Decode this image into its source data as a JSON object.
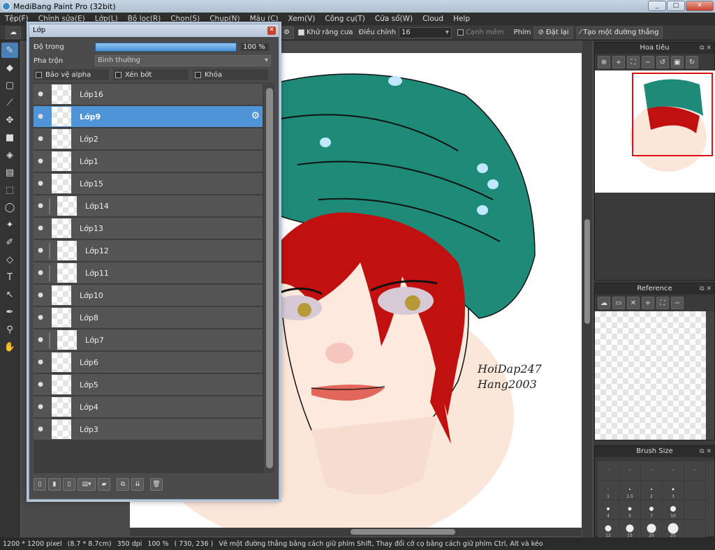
{
  "window": {
    "title": "MediBang Paint Pro (32bit)",
    "min": "_",
    "max": "□",
    "close": "✕"
  },
  "menu": [
    "Tệp(F)",
    "Chỉnh sửa(E)",
    "Lớp(L)",
    "Bộ lọc(R)",
    "Chọn(S)",
    "Chụp(N)",
    "Màu (C)",
    "Xem(V)",
    "Công cụ(T)",
    "Cửa sổ(W)",
    "Cloud",
    "Help"
  ],
  "toolbar": {
    "antialias": "Khử răng cưa",
    "correction_label": "Điều chỉnh",
    "correction_value": "16",
    "soft_edge": "Cạnh mềm",
    "key_label": "Phím",
    "reset": "Đặt lại",
    "straight_line": "Tạo một đường thẳng"
  },
  "layer_panel": {
    "title": "Lớp",
    "opacity_label": "Độ trong",
    "opacity_value": "100 %",
    "opacity": 1.0,
    "blend_label": "Pha trộn",
    "blend_value": "Bình thường",
    "protect_alpha": "Bảo vệ alpha",
    "clipping": "Xén bớt",
    "lock": "Khóa",
    "layers": [
      {
        "name": "Lớp16",
        "selected": false,
        "clipped": false
      },
      {
        "name": "Lớp9",
        "selected": true,
        "clipped": false
      },
      {
        "name": "Lớp2",
        "selected": false,
        "clipped": false
      },
      {
        "name": "Lớp1",
        "selected": false,
        "clipped": false
      },
      {
        "name": "Lớp15",
        "selected": false,
        "clipped": false
      },
      {
        "name": "Lớp14",
        "selected": false,
        "clipped": true
      },
      {
        "name": "Lớp13",
        "selected": false,
        "clipped": false
      },
      {
        "name": "Lớp12",
        "selected": false,
        "clipped": true
      },
      {
        "name": "Lớp11",
        "selected": false,
        "clipped": true
      },
      {
        "name": "Lớp10",
        "selected": false,
        "clipped": false
      },
      {
        "name": "Lớp8",
        "selected": false,
        "clipped": false
      },
      {
        "name": "Lớp7",
        "selected": false,
        "clipped": true
      },
      {
        "name": "Lớp6",
        "selected": false,
        "clipped": false
      },
      {
        "name": "Lớp5",
        "selected": false,
        "clipped": false
      },
      {
        "name": "Lớp4",
        "selected": false,
        "clipped": false
      },
      {
        "name": "Lớp3",
        "selected": false,
        "clipped": false
      }
    ]
  },
  "navigator": {
    "title": "Hoa tiêu"
  },
  "reference": {
    "title": "Reference"
  },
  "brush_size": {
    "title": "Brush Size",
    "sizes": [
      "",
      "",
      "",
      "",
      "",
      "1",
      "1.5",
      "2",
      "3",
      "",
      "4",
      "5",
      "7",
      "10",
      "",
      "12",
      "15",
      "20",
      "25",
      ""
    ]
  },
  "canvas": {
    "signature_line1": "HoiDap247",
    "signature_line2": "Hang2003"
  },
  "status": {
    "size": "1200 * 1200 pixel",
    "cm": "(8.7 * 8.7cm)",
    "dpi": "350 dpi",
    "zoom": "100 %",
    "coords": "( 730, 236 )",
    "hint": "Vẽ một đường thẳng bằng cách giữ phím Shift, Thay đổi cỡ cọ bằng cách giữ phím Ctrl, Alt và kéo"
  },
  "colors": {
    "accent": "#4f94d6",
    "hat": "#1e8a78",
    "hair": "#c01010",
    "skin": "#fbe6da"
  }
}
